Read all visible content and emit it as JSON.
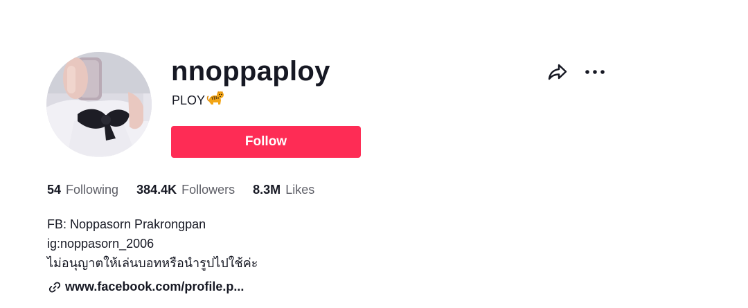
{
  "profile": {
    "username": "nnoppaploy",
    "nickname": "PLOY",
    "nickname_emoji": "tiger-emoji",
    "follow_label": "Follow",
    "avatar": "profile-photo"
  },
  "stats": [
    {
      "value": "54",
      "label": "Following"
    },
    {
      "value": "384.4K",
      "label": "Followers"
    },
    {
      "value": "8.3M",
      "label": "Likes"
    }
  ],
  "bio": {
    "lines": [
      "FB: Noppasorn Prakrongpan",
      "ig:noppasorn_2006",
      "ไม่อนุญาตให้เล่นบอทหรือนำรูปไปใช้ค่ะ"
    ],
    "link": "www.facebook.com/profile.p..."
  },
  "actions": {
    "share_icon": "share-icon",
    "more_icon": "more-icon"
  },
  "colors": {
    "accent": "#fe2c55",
    "text": "#161823",
    "secondary_text": "#5d5e66"
  }
}
